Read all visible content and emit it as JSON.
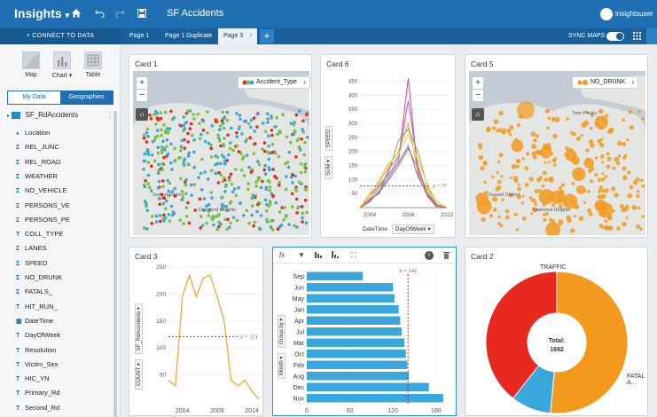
{
  "app": {
    "brand": "Insights",
    "brand_caret": "▾",
    "document_title": "SF Accidents",
    "user": "insightsuser",
    "home_icon": "home-icon",
    "undo_icon": "undo-icon",
    "redo_icon": "redo-icon",
    "save_icon": "save-icon",
    "grid_icon": "grid-icon",
    "accent": "#1f6fb2"
  },
  "tabbar": {
    "connect": "+  CONNECT TO DATA",
    "tabs": [
      "Page 1",
      "Page 1 Duplicate",
      "Page 3"
    ],
    "active_tab_close": "×",
    "add": "+",
    "sync_maps": "SYNC MAPS"
  },
  "sidebar": {
    "tools": [
      "Map",
      "Chart ▾",
      "Table"
    ],
    "segments": [
      "My Data",
      "Geographies"
    ],
    "dataset": "SF_RdAccidents",
    "dataset_menu": "⋮",
    "fields": [
      {
        "type": "loc",
        "name": "Location"
      },
      {
        "type": "Σ",
        "name": "REL_JUNC"
      },
      {
        "type": "Σ",
        "name": "REL_ROAD"
      },
      {
        "type": "Σ",
        "name": "WEATHER"
      },
      {
        "type": "Σ",
        "name": "NO_VEHICLE"
      },
      {
        "type": "Σ",
        "name": "PERSONS_VE"
      },
      {
        "type": "Σ",
        "name": "PERSONS_PE"
      },
      {
        "type": "T",
        "name": "COLL_TYPE"
      },
      {
        "type": "Σ",
        "name": "LANES"
      },
      {
        "type": "Σ",
        "name": "SPEED"
      },
      {
        "type": "Σ",
        "name": "NO_DRUNK"
      },
      {
        "type": "Σ",
        "name": "FATALS_"
      },
      {
        "type": "T",
        "name": "HIT_RUN_"
      },
      {
        "type": "date",
        "name": "DateTime"
      },
      {
        "type": "T",
        "name": "DayOfWeek"
      },
      {
        "type": "T",
        "name": "Resolution"
      },
      {
        "type": "T",
        "name": "Victim_Sex"
      },
      {
        "type": "T",
        "name": "HIC_YN"
      },
      {
        "type": "T",
        "name": "Primary_Rd"
      },
      {
        "type": "T",
        "name": "Second_Rd"
      }
    ]
  },
  "cards": {
    "card1": {
      "title": "Card 1",
      "legend": "Accident_Type",
      "zoom_in": "+",
      "zoom_out": "−",
      "places": [
        "Sunset District",
        "Diamond Heights"
      ]
    },
    "card6": {
      "title": "Card 6",
      "ylab_field": "SPEED",
      "ylab_agg": "SUM ▾",
      "x_field": "DateTime",
      "x_group": "DayOfWeek ▾"
    },
    "card5": {
      "title": "Card 5",
      "legend": "NO_DRUNK",
      "zoom_in": "+",
      "zoom_out": "−",
      "places": [
        "Twin Peaks",
        "Sunset District",
        "Diamond Heights"
      ]
    },
    "card3": {
      "title": "Card 3",
      "ylab_field": "SF_RdAccidents ▾",
      "ylab_agg": "COUNT ▾"
    },
    "card4": {
      "toolbar": [
        "fx",
        "▼",
        "⫶",
        "⫶",
        "⛶"
      ],
      "ylab_field": "Group by ▾",
      "ylab_agg": "Month ▾",
      "info": "i",
      "trash": "🗑"
    },
    "card2": {
      "title": "Card 2",
      "total_label": "Total:",
      "total_value": "1692",
      "slice_labels": [
        "TRAFFIC",
        "FATAL A..."
      ]
    }
  },
  "chart_data": [
    {
      "type": "line",
      "card": "Card 6",
      "x": [
        2003,
        2004,
        2005,
        2006,
        2007,
        2008,
        2009,
        2010,
        2011,
        2012
      ],
      "ylim": [
        0,
        480
      ],
      "yticks": [
        50,
        100,
        150,
        200,
        250,
        300,
        350,
        400,
        450
      ],
      "xticks": [
        "2004",
        "2008",
        "2012"
      ],
      "series": [
        {
          "color": "#e84c8b",
          "values": [
            0,
            40,
            80,
            120,
            170,
            460,
            120,
            40,
            0,
            0
          ]
        },
        {
          "color": "#f2a83a",
          "values": [
            0,
            50,
            90,
            150,
            200,
            300,
            130,
            60,
            10,
            0
          ]
        },
        {
          "color": "#7bc043",
          "values": [
            0,
            30,
            70,
            130,
            240,
            280,
            200,
            70,
            20,
            0
          ]
        },
        {
          "color": "#3ea0dc",
          "values": [
            0,
            20,
            60,
            110,
            160,
            220,
            110,
            50,
            10,
            0
          ]
        },
        {
          "color": "#a86ad8",
          "values": [
            0,
            30,
            50,
            140,
            180,
            380,
            150,
            40,
            5,
            0
          ]
        },
        {
          "color": "#f0d24a",
          "values": [
            0,
            40,
            100,
            160,
            190,
            260,
            170,
            80,
            20,
            0
          ]
        },
        {
          "color": "#e8613f",
          "values": [
            0,
            25,
            55,
            100,
            150,
            210,
            140,
            45,
            5,
            0
          ]
        }
      ],
      "mean_label": "x̄ = 77",
      "mean": 77
    },
    {
      "type": "line",
      "card": "Card 3",
      "x": [
        2002,
        2003,
        2004,
        2005,
        2006,
        2007,
        2008,
        2009,
        2010,
        2011,
        2012,
        2013,
        2014,
        2015
      ],
      "values": [
        40,
        30,
        195,
        235,
        195,
        230,
        235,
        195,
        150,
        40,
        30,
        40,
        20,
        5
      ],
      "ylim": [
        0,
        250
      ],
      "yticks": [
        50,
        100,
        150,
        200,
        250
      ],
      "xticks": [
        "2004",
        "2009",
        "2014"
      ],
      "mean_label": "x̄ = 121",
      "mean": 121,
      "color": "#f2a83a"
    },
    {
      "type": "bar",
      "card": "Card 4",
      "orientation": "horizontal",
      "categories": [
        "Sep",
        "Jun",
        "May",
        "Jan",
        "Apr",
        "Jul",
        "Mar",
        "Oct",
        "Feb",
        "Aug",
        "Dec",
        "Nov"
      ],
      "values": [
        78,
        120,
        122,
        128,
        130,
        132,
        136,
        138,
        140,
        142,
        170,
        190
      ],
      "xlim": [
        0,
        200
      ],
      "xticks": [
        0,
        60,
        120,
        180
      ],
      "mean_label": "x̄ = 141",
      "mean": 141,
      "color": "#3aa7dc"
    },
    {
      "type": "pie",
      "card": "Card 2",
      "donut": true,
      "labels": [
        "TRAFFIC",
        "FATAL A...",
        ""
      ],
      "values": [
        870,
        155,
        667
      ],
      "colors": [
        "#f39a1e",
        "#3aa7dc",
        "#e8291f"
      ]
    }
  ]
}
